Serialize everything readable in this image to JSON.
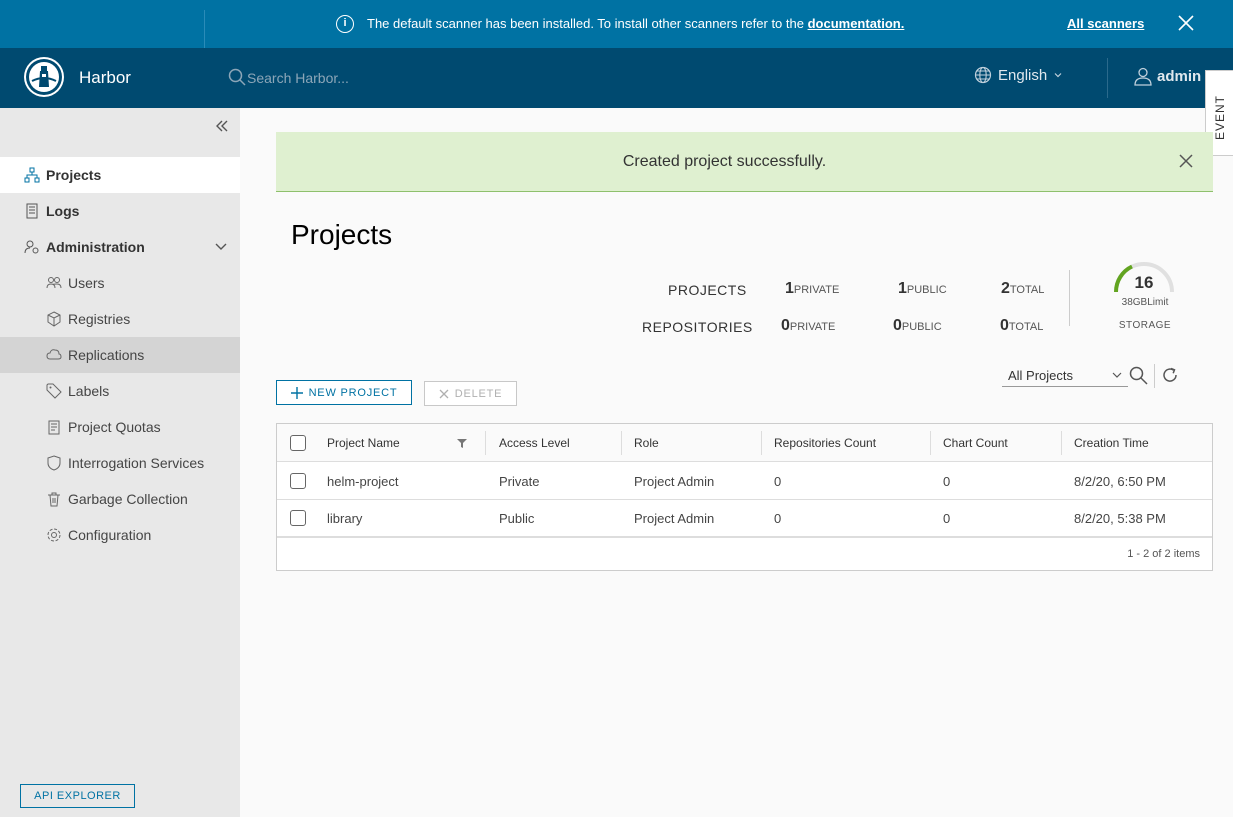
{
  "banner": {
    "message": "The default scanner has been installed. To install other scanners refer to the ",
    "link_text": "documentation.",
    "all_scanners": "All scanners"
  },
  "header": {
    "app_title": "Harbor",
    "search_placeholder": "Search Harbor...",
    "language": "English",
    "user": "admin"
  },
  "event_tab": "EVENT",
  "sidebar": {
    "items": [
      {
        "label": "Projects",
        "icon": "projects-icon"
      },
      {
        "label": "Logs",
        "icon": "logs-icon"
      },
      {
        "label": "Administration",
        "icon": "administration-icon"
      },
      {
        "label": "Users",
        "icon": "users-icon"
      },
      {
        "label": "Registries",
        "icon": "registries-icon"
      },
      {
        "label": "Replications",
        "icon": "replications-icon"
      },
      {
        "label": "Labels",
        "icon": "labels-icon"
      },
      {
        "label": "Project Quotas",
        "icon": "project-quotas-icon"
      },
      {
        "label": "Interrogation Services",
        "icon": "interrogation-services-icon"
      },
      {
        "label": "Garbage Collection",
        "icon": "garbage-collection-icon"
      },
      {
        "label": "Configuration",
        "icon": "configuration-icon"
      }
    ],
    "api_explorer": "API EXPLORER"
  },
  "alert": {
    "message": "Created project successfully."
  },
  "page_title": "Projects",
  "stats": {
    "projects_label": "PROJECTS",
    "repositories_label": "REPOSITORIES",
    "projects": {
      "private": "1",
      "public": "1",
      "total": "2"
    },
    "repositories": {
      "private": "0",
      "public": "0",
      "total": "0"
    },
    "private_suffix": "PRIVATE",
    "public_suffix": "PUBLIC",
    "total_suffix": "TOTAL",
    "storage_value": "16",
    "storage_limit": "38GBLimit",
    "storage_label": "STORAGE"
  },
  "toolbar": {
    "new_project": "NEW PROJECT",
    "delete": "DELETE",
    "filter_value": "All Projects"
  },
  "table": {
    "columns": [
      "Project Name",
      "Access Level",
      "Role",
      "Repositories Count",
      "Chart Count",
      "Creation Time"
    ],
    "rows": [
      {
        "name": "helm-project",
        "access": "Private",
        "role": "Project Admin",
        "repos": "0",
        "charts": "0",
        "created": "8/2/20, 6:50 PM"
      },
      {
        "name": "library",
        "access": "Public",
        "role": "Project Admin",
        "repos": "0",
        "charts": "0",
        "created": "8/2/20, 5:38 PM"
      }
    ],
    "footer": "1 - 2 of 2 items"
  }
}
